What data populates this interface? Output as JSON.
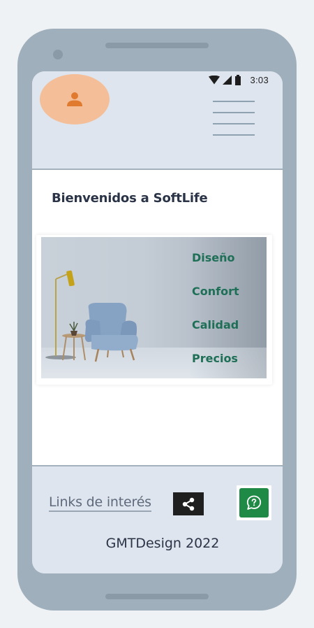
{
  "status_bar": {
    "time": "3:03"
  },
  "header": {
    "avatar_icon": "user-icon",
    "menu_icon": "hamburger-menu-icon"
  },
  "main": {
    "welcome_title": "Bienvenidos a SoftLife",
    "hero_menu": [
      {
        "label": "Diseño"
      },
      {
        "label": "Confort"
      },
      {
        "label": "Calidad"
      },
      {
        "label": "Precios"
      }
    ]
  },
  "footer": {
    "links_label": "Links de interés",
    "share_icon": "share-icon",
    "help_icon": "help-chat-icon",
    "copyright": "GMTDesign 2022"
  },
  "colors": {
    "phone_frame": "#9fafbb",
    "screen_bg": "#dee5ee",
    "avatar_bg": "#f4be98",
    "avatar_icon": "#e07a2e",
    "hero_link": "#1f6f57",
    "help_button": "#1f8a45"
  }
}
